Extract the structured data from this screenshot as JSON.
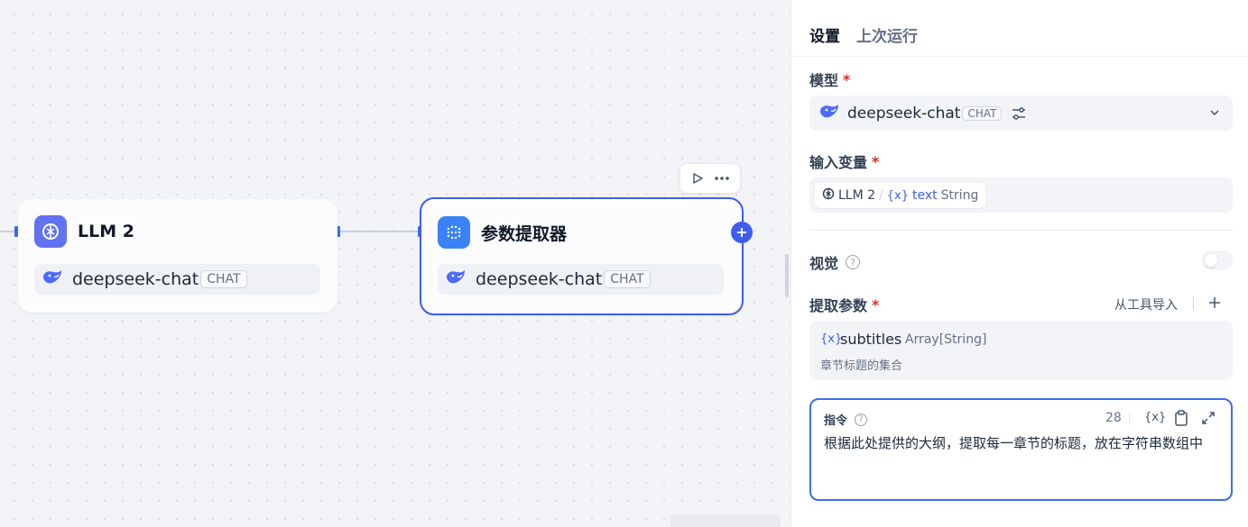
{
  "canvas": {
    "nodes": [
      {
        "title": "LLM 2",
        "model": "deepseek-chat",
        "badge": "CHAT",
        "icon": "llm-icon",
        "icon_color": "#6172f3"
      },
      {
        "title": "参数提取器",
        "model": "deepseek-chat",
        "badge": "CHAT",
        "icon": "parameter-extractor-icon",
        "icon_color": "#3b82f6"
      }
    ],
    "toolbar": {
      "run_icon": "play-icon",
      "more_icon": "more-icon"
    },
    "add_icon": "plus-icon"
  },
  "panel": {
    "tabs": [
      "设置",
      "上次运行"
    ],
    "model": {
      "label": "模型",
      "required_mark": "*",
      "value": "deepseek-chat",
      "badge": "CHAT",
      "icons": [
        "deepseek-icon",
        "settings-sliders-icon",
        "chevron-down-icon"
      ]
    },
    "input_var": {
      "label": "输入变量",
      "required_mark": "*",
      "node": "LLM 2",
      "separator": "/",
      "var_symbol": "{x}",
      "var_name": "text",
      "var_type": "String"
    },
    "vision": {
      "label": "视觉",
      "help": "?",
      "enabled": false
    },
    "params": {
      "label": "提取参数",
      "required_mark": "*",
      "import_label": "从工具导入",
      "add_icon": "plus-icon",
      "items": [
        {
          "symbol": "{x}",
          "name": "subtitles",
          "type": "Array[String]",
          "desc": "章节标题的集合"
        }
      ]
    },
    "instruction": {
      "label": "指令",
      "help": "?",
      "count": "28",
      "var_button": "{x}",
      "text": "根据此处提供的大纲，提取每一章节的标题，放在字符串数组中",
      "icons": [
        "clipboard-icon",
        "expand-icon"
      ]
    }
  },
  "colors": {
    "accent": "#3f5ef0",
    "required": "#d92d20"
  }
}
